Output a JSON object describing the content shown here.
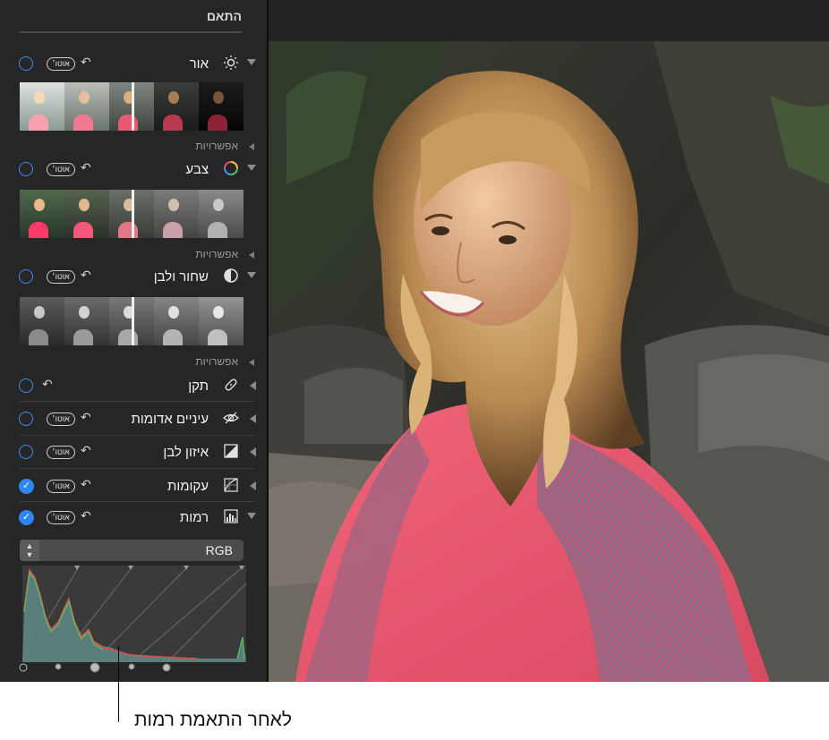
{
  "panel": {
    "title": "התאם",
    "options_label": "אפשרויות",
    "auto_label": "אוטו׳",
    "undo_glyph": "↶"
  },
  "adjustments": [
    {
      "id": "light",
      "label": "אור",
      "icon": "sun-icon",
      "checked": false,
      "expanded": true,
      "auto": true
    },
    {
      "id": "color",
      "label": "צבע",
      "icon": "color-wheel-icon",
      "checked": false,
      "expanded": true,
      "auto": true
    },
    {
      "id": "bw",
      "label": "שחור ולבן",
      "icon": "half-circle-icon",
      "checked": false,
      "expanded": true,
      "auto": true
    },
    {
      "id": "retouch",
      "label": "תקן",
      "icon": "bandage-icon",
      "checked": false,
      "expanded": false,
      "auto": false
    },
    {
      "id": "redeye",
      "label": "עיניים אדומות",
      "icon": "eye-icon",
      "checked": false,
      "expanded": false,
      "auto": true
    },
    {
      "id": "wb",
      "label": "איזון לבן",
      "icon": "white-balance-icon",
      "checked": false,
      "expanded": false,
      "auto": true
    },
    {
      "id": "curves",
      "label": "עקומות",
      "icon": "curves-icon",
      "checked": true,
      "expanded": false,
      "auto": true
    },
    {
      "id": "levels",
      "label": "רמות",
      "icon": "levels-icon",
      "checked": true,
      "expanded": true,
      "auto": true
    }
  ],
  "levels": {
    "channel": "RGB"
  },
  "caption": "לאחר התאמת רמות",
  "colors": {
    "accent": "#2d86f4",
    "sidebar": "#262626",
    "shirt": "#e8546a"
  }
}
